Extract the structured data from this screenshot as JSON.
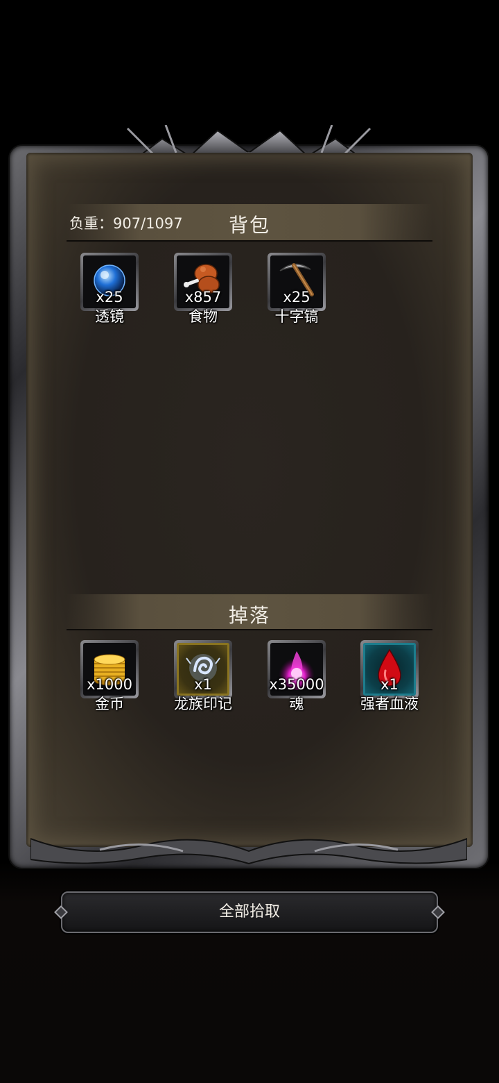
{
  "backpack": {
    "title": "背包",
    "weight_text": "负重：907/1097",
    "items": [
      {
        "name": "透镜",
        "count": "x25",
        "icon": "blue-orb-icon"
      },
      {
        "name": "食物",
        "count": "x857",
        "icon": "drumstick-icon"
      },
      {
        "name": "十字镐",
        "count": "x25",
        "icon": "pickaxe-icon"
      }
    ]
  },
  "drops": {
    "title": "掉落",
    "items": [
      {
        "name": "金币",
        "count": "x1000",
        "icon": "gold-coins-icon"
      },
      {
        "name": "龙族印记",
        "count": "x1",
        "icon": "dragon-mark-icon"
      },
      {
        "name": "魂",
        "count": "x35000",
        "icon": "soul-flame-icon"
      },
      {
        "name": "强者血液",
        "count": "x1",
        "icon": "blood-drop-icon"
      }
    ]
  },
  "actions": {
    "pickup_all": "全部拾取"
  },
  "colors": {
    "text": "#f2eee6",
    "panel_bg": "#27221d",
    "header_bar": "#5e5440",
    "frame_metal": "#8a8a90"
  }
}
